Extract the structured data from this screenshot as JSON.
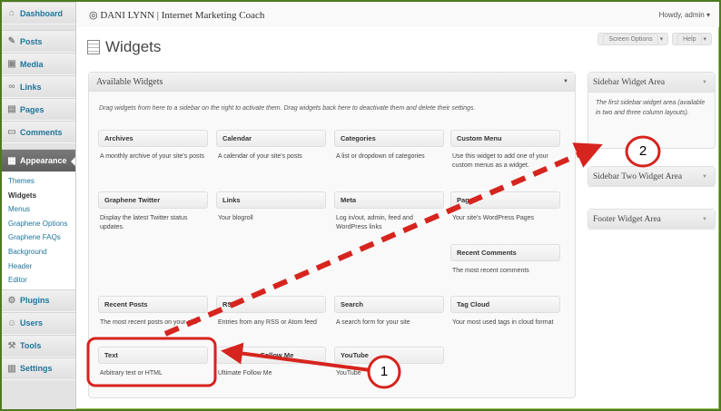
{
  "colors": {
    "accent": "#21759b",
    "annotation_red": "#d6241e",
    "frame_green": "#4d7a1f"
  },
  "sidebar": {
    "items": [
      {
        "label": "Dashboard",
        "icon": "dashboard-icon"
      },
      {
        "label": "Posts",
        "icon": "posts-icon"
      },
      {
        "label": "Media",
        "icon": "media-icon"
      },
      {
        "label": "Links",
        "icon": "links-icon"
      },
      {
        "label": "Pages",
        "icon": "pages-icon"
      },
      {
        "label": "Comments",
        "icon": "comments-icon"
      }
    ],
    "appearance": {
      "label": "Appearance",
      "icon": "appearance-icon"
    },
    "submenu": [
      "Themes",
      "Widgets",
      "Menus",
      "Graphene Options",
      "Graphene FAQs",
      "Background",
      "Header",
      "Editor"
    ],
    "bottom_items": [
      {
        "label": "Plugins",
        "icon": "plugins-icon"
      },
      {
        "label": "Users",
        "icon": "users-icon"
      },
      {
        "label": "Tools",
        "icon": "tools-icon"
      },
      {
        "label": "Settings",
        "icon": "settings-icon"
      }
    ]
  },
  "header": {
    "site_title": "DANI LYNN | Internet Marketing Coach",
    "howdy": "Howdy, admin",
    "screen_options": "Screen Options",
    "help": "Help"
  },
  "page_title": "Widgets",
  "available": {
    "title": "Available Widgets",
    "description": "Drag widgets from here to a sidebar on the right to activate them. Drag widgets back here to deactivate them and delete their settings.",
    "widgets": [
      {
        "title": "Archives",
        "desc": "A monthly archive of your site's posts"
      },
      {
        "title": "Calendar",
        "desc": "A calendar of your site's posts"
      },
      {
        "title": "Categories",
        "desc": "A list or dropdown of categories"
      },
      {
        "title": "Custom Menu",
        "desc": "Use this widget to add one of your custom menus as a widget."
      },
      {
        "title": "Graphene Twitter",
        "desc": "Display the latest Twitter status updates."
      },
      {
        "title": "Links",
        "desc": "Your blogroll"
      },
      {
        "title": "Meta",
        "desc": "Log in/out, admin, feed and WordPress links"
      },
      {
        "title": "Pages",
        "desc": "Your site's WordPress Pages"
      },
      {
        "title": "Recent Comments",
        "desc": "The most recent comments"
      },
      {
        "title": "Recent Posts",
        "desc": "The most recent posts on your site"
      },
      {
        "title": "RSS",
        "desc": "Entries from any RSS or Atom feed"
      },
      {
        "title": "Search",
        "desc": "A search form for your site"
      },
      {
        "title": "Tag Cloud",
        "desc": "Your most used tags in cloud format"
      },
      {
        "title": "Text",
        "desc": "Arbitrary text or HTML"
      },
      {
        "title": "Follow Me",
        "desc": "Ultimate Follow Me"
      },
      {
        "title": "YouTube",
        "desc": "YouTube"
      }
    ]
  },
  "right_areas": [
    {
      "title": "Sidebar Widget Area",
      "desc": "The first sidebar widget area (available in two and three column layouts)."
    },
    {
      "title": "Sidebar Two Widget Area",
      "desc": ""
    },
    {
      "title": "Footer Widget Area",
      "desc": ""
    }
  ],
  "annotations": {
    "step1": "1",
    "step2": "2"
  }
}
